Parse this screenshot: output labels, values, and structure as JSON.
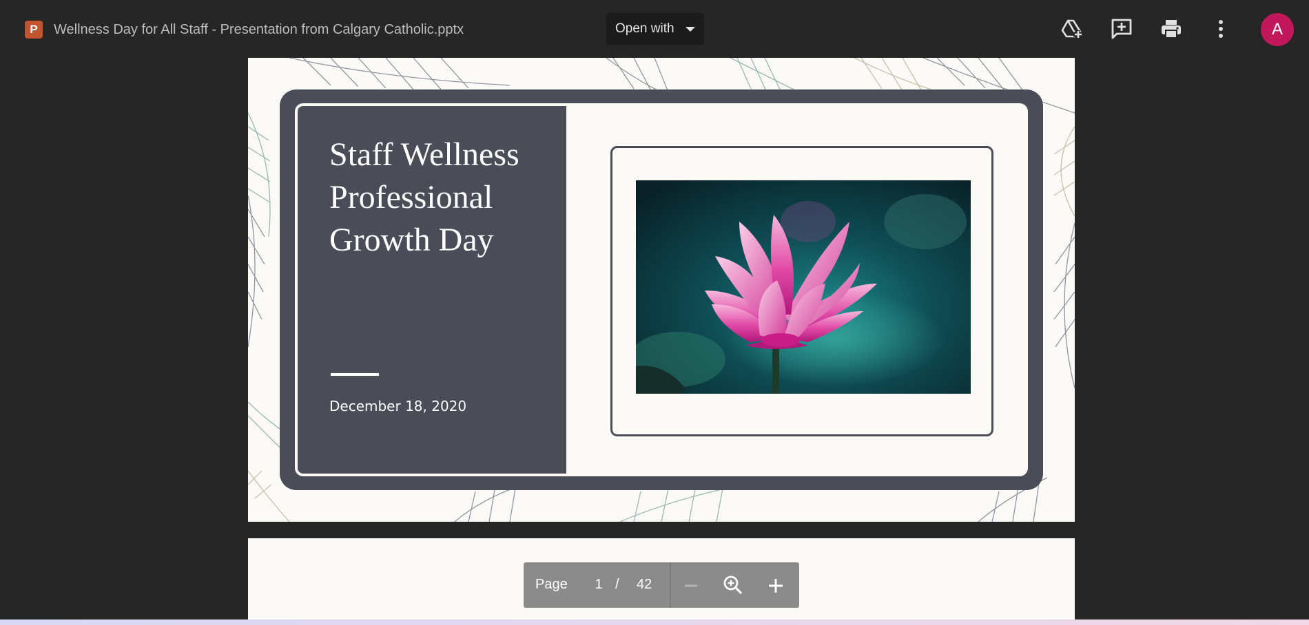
{
  "header": {
    "file_icon_letter": "P",
    "file_title": "Wellness Day for All Staff - Presentation from Calgary Catholic.pptx",
    "open_with_label": "Open with",
    "avatar_letter": "A",
    "icons": [
      "add-to-drive-icon",
      "add-comment-icon",
      "print-icon",
      "more-options-icon"
    ]
  },
  "slide": {
    "title_lines": [
      "Staff Wellness",
      "Professional",
      "Growth Day"
    ],
    "date": "December 18, 2020",
    "image": "pink-lotus-flower-photo"
  },
  "pager": {
    "page_label": "Page",
    "current_page": "1",
    "separator": "/",
    "total_pages": "42"
  },
  "colors": {
    "app_background": "#262626",
    "slide_panel": "#4a4c57",
    "avatar": "#c2185b",
    "file_icon": "#c1552f"
  }
}
